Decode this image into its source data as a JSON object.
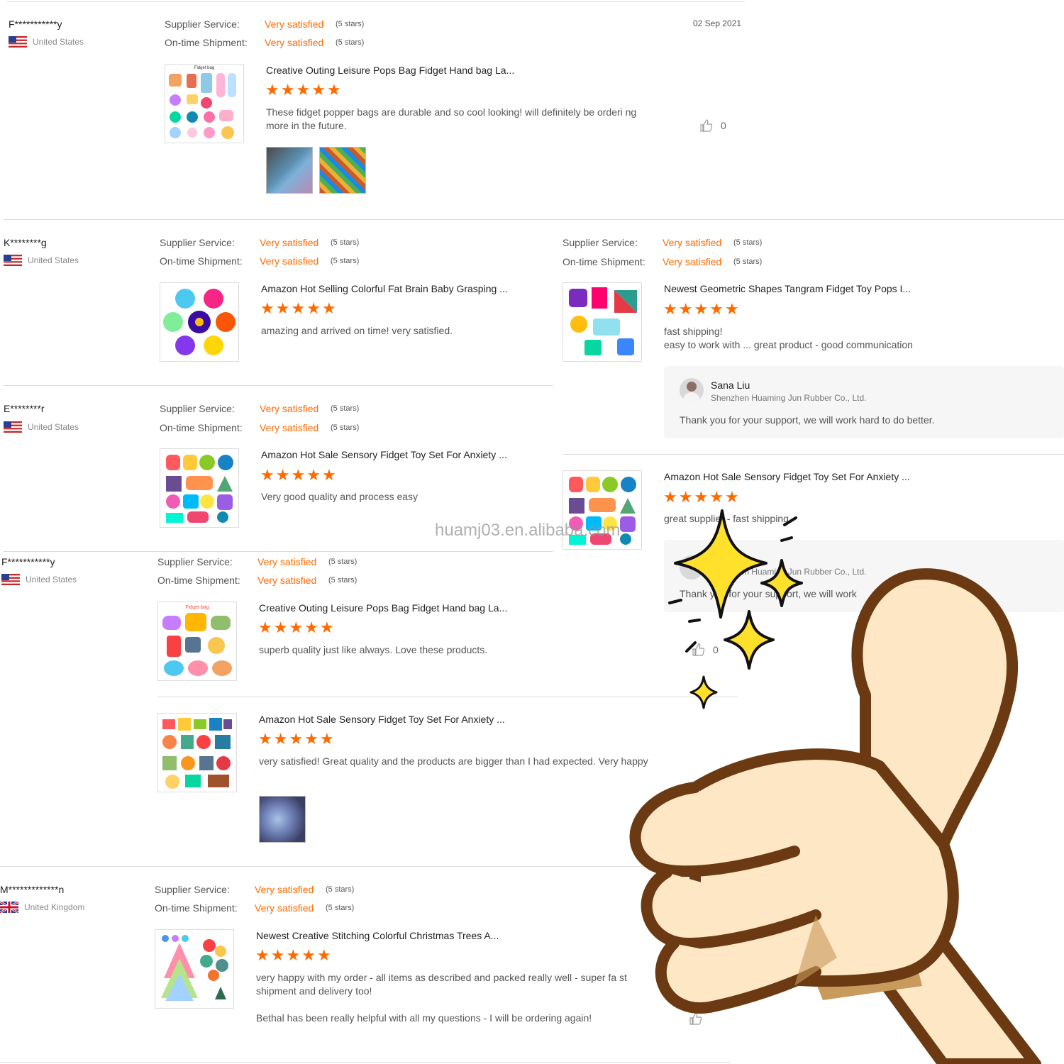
{
  "labels": {
    "supplier_service": "Supplier Service:",
    "ontime_shipment": "On-time Shipment:",
    "very_satisfied": "Very satisfied",
    "five_stars": "(5 stars)"
  },
  "reviews": [
    {
      "name": "F***********y",
      "country": "United States",
      "date": "02 Sep 2021",
      "product": "Creative Outing Leisure Pops Bag Fidget Hand bag La...",
      "thumb_label": "Fidget bag",
      "text": "These fidget popper bags are durable and so cool looking! will definitely be orderi ng more in the future.",
      "likes": "0"
    },
    {
      "name": "K********g",
      "country": "United States",
      "product": "Amazon Hot Selling Colorful Fat Brain Baby Grasping ...",
      "text": "amazing and arrived on time! very satisfied."
    },
    {
      "product": "Newest Geometric Shapes Tangram Fidget Toy Pops I...",
      "text_line1": "fast shipping!",
      "text_line2": "easy to work with ... great product - good communication",
      "reply_name": "Sana Liu",
      "reply_company": "Shenzhen Huaming Jun Rubber Co., Ltd.",
      "reply_text": "Thank you for your support, we will work hard to do better."
    },
    {
      "name": "E********r",
      "country": "United States",
      "product": "Amazon Hot Sale Sensory Fidget Toy Set For Anxiety ...",
      "text": "Very good quality and process easy"
    },
    {
      "product": "Amazon Hot Sale Sensory Fidget Toy Set For Anxiety ...",
      "text": "great supplier - fast shipping",
      "reply_company": "Shenzhen Huaming Jun Rubber Co., Ltd.",
      "reply_text": "Thank you for your support, we will work",
      "likes": "0"
    },
    {
      "name": "F***********y",
      "country": "United States",
      "product": "Creative Outing Leisure Pops Bag Fidget Hand bag La...",
      "thumb_label": "Fidget bag",
      "text": "superb quality just like always. Love these products."
    },
    {
      "product": "Amazon Hot Sale Sensory Fidget Toy Set For Anxiety ...",
      "text": "very satisfied! Great quality and the products are bigger than I had expected. Very happy"
    },
    {
      "name": "M*************n",
      "country": "United Kingdom",
      "product": "Newest Creative Stitching Colorful Christmas Trees A...",
      "text": "very happy with my order - all items as described and packed really well - super fa st shipment and delivery too!",
      "text2": "Bethal has been really helpful with all my questions - I will be ordering again!"
    }
  ],
  "watermark": "huamj03.en.alibaba.com",
  "colors": {
    "accent": "#ff6a00",
    "star": "#ff6a00",
    "hand_outline": "#6b3a12",
    "hand_fill": "#fde7c4",
    "sparkle": "#ffe02a"
  },
  "icons": [
    "us-flag-icon",
    "uk-flag-icon",
    "thumbs-up-icon",
    "star-icon",
    "sparkle-icon",
    "avatar"
  ]
}
